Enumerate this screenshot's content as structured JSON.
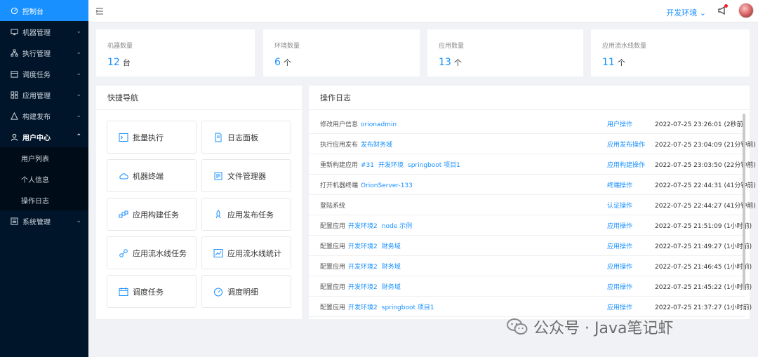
{
  "sidebar": {
    "items": [
      {
        "label": "控制台",
        "icon": "dashboard-icon"
      },
      {
        "label": "机器管理",
        "icon": "monitor-icon"
      },
      {
        "label": "执行管理",
        "icon": "sitemap-icon"
      },
      {
        "label": "调度任务",
        "icon": "calendar-icon"
      },
      {
        "label": "应用管理",
        "icon": "apps-icon"
      },
      {
        "label": "构建发布",
        "icon": "build-icon"
      },
      {
        "label": "用户中心",
        "icon": "user-icon"
      },
      {
        "label": "系统管理",
        "icon": "settings-icon"
      }
    ],
    "user_sub": [
      "用户列表",
      "个人信息",
      "操作日志"
    ]
  },
  "header": {
    "env": "开发环境"
  },
  "stats": [
    {
      "label": "机器数量",
      "value": "12",
      "unit": "台"
    },
    {
      "label": "环境数量",
      "value": "6",
      "unit": "个"
    },
    {
      "label": "应用数量",
      "value": "13",
      "unit": "个"
    },
    {
      "label": "应用流水线数量",
      "value": "11",
      "unit": "个"
    }
  ],
  "quick_nav": {
    "title": "快捷导航",
    "items": [
      {
        "label": "批量执行",
        "icon": "terminal-icon"
      },
      {
        "label": "日志面板",
        "icon": "file-icon"
      },
      {
        "label": "机器终端",
        "icon": "cloud-icon"
      },
      {
        "label": "文件管理器",
        "icon": "folder-icon"
      },
      {
        "label": "应用构建任务",
        "icon": "blocks-icon"
      },
      {
        "label": "应用发布任务",
        "icon": "rocket-icon"
      },
      {
        "label": "应用流水线任务",
        "icon": "link-icon"
      },
      {
        "label": "应用流水线统计",
        "icon": "chart-icon"
      },
      {
        "label": "调度任务",
        "icon": "schedule-icon"
      },
      {
        "label": "调度明细",
        "icon": "gauge-icon"
      }
    ]
  },
  "logs": {
    "title": "操作日志",
    "rows": [
      {
        "text": "修改用户信息",
        "links": [
          "orionadmin"
        ],
        "type": "用户操作",
        "time": "2022-07-25 23:26:01 (2秒前)"
      },
      {
        "text": "执行应用发布",
        "links": [
          "发布财务域"
        ],
        "type": "应用发布操作",
        "time": "2022-07-25 23:04:09 (21分钟前)"
      },
      {
        "text": "重新构建应用",
        "links": [
          "#31",
          "开发环境",
          "springboot 项目1"
        ],
        "type": "应用构建操作",
        "time": "2022-07-25 23:03:50 (22分钟前)"
      },
      {
        "text": "打开机器终端",
        "links": [
          "OrionServer-133"
        ],
        "type": "终端操作",
        "time": "2022-07-25 22:44:31 (41分钟前)"
      },
      {
        "text": "登陆系统",
        "links": [],
        "type": "认证操作",
        "time": "2022-07-25 22:44:27 (41分钟前)"
      },
      {
        "text": "配置应用",
        "links": [
          "开发环境2",
          "node 示例"
        ],
        "type": "应用操作",
        "time": "2022-07-25 21:51:09 (1小时前)"
      },
      {
        "text": "配置应用",
        "links": [
          "开发环境2",
          "财务域"
        ],
        "type": "应用操作",
        "time": "2022-07-25 21:49:27 (1小时前)"
      },
      {
        "text": "配置应用",
        "links": [
          "开发环境2",
          "财务域"
        ],
        "type": "应用操作",
        "time": "2022-07-25 21:46:45 (1小时前)"
      },
      {
        "text": "配置应用",
        "links": [
          "开发环境2",
          "财务域"
        ],
        "type": "应用操作",
        "time": "2022-07-25 21:45:22 (1小时前)"
      },
      {
        "text": "配置应用",
        "links": [
          "开发环境2",
          "springboot 项目1"
        ],
        "type": "应用操作",
        "time": "2022-07-25 21:37:27 (1小时前)"
      }
    ]
  },
  "watermark": {
    "text": "公众号 · Java笔记虾"
  }
}
